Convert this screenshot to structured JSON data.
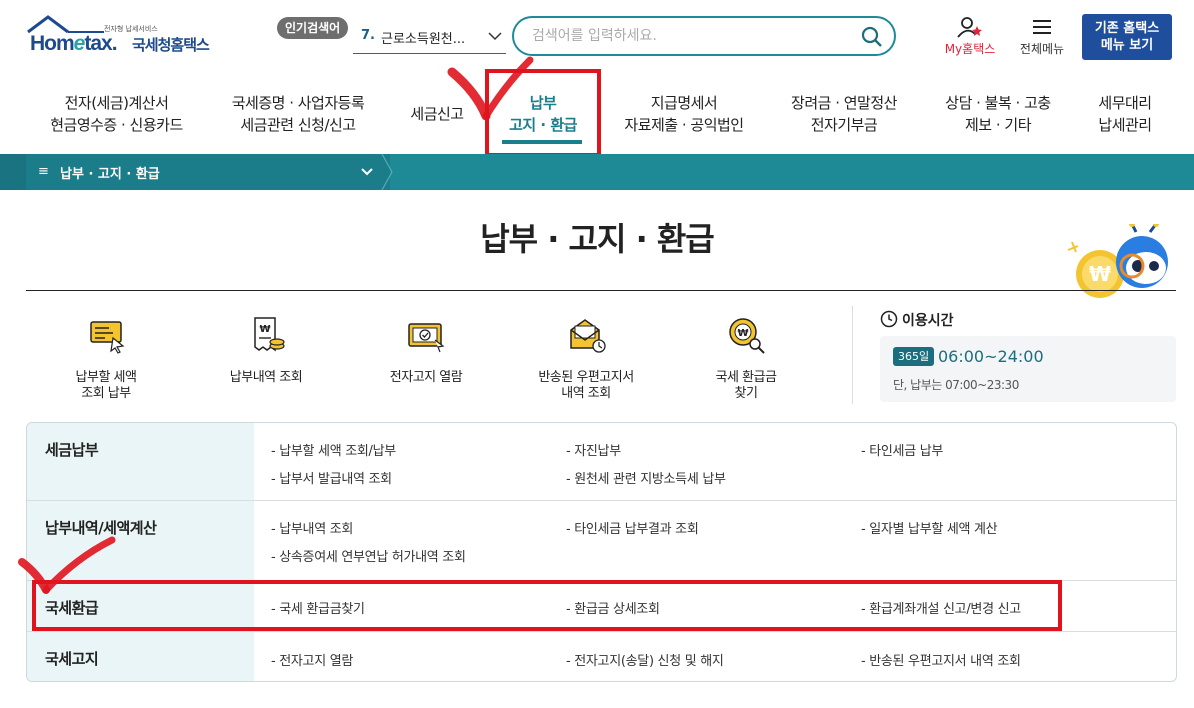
{
  "header": {
    "logo_tagline": "전자형 납세서비스",
    "logo_name_a": "Hom",
    "logo_name_e": "e",
    "logo_name_b": "tax.",
    "logo_kr": "국세청홈택스",
    "popular_badge": "인기검색어",
    "popular_num": "7.",
    "popular_text": "근로소득원천...",
    "search_placeholder": "검색어를 입력하세요.",
    "my_prefix": "My",
    "my_suffix": "홈택스",
    "all_menu": "전체메뉴",
    "old_menu_line1": "기존 홈택스",
    "old_menu_line2": "메뉴 보기"
  },
  "gnb": [
    {
      "line1": "전자(세금)계산서",
      "line2": "현금영수증 · 신용카드"
    },
    {
      "line1": "국세증명 · 사업자등록",
      "line2": "세금관련 신청/신고"
    },
    {
      "line1": "세금신고",
      "line2": ""
    },
    {
      "line1": "납부",
      "line2": "고지 · 환급"
    },
    {
      "line1": "지급명세서",
      "line2": "자료제출 · 공익법인"
    },
    {
      "line1": "장려금 · 연말정산",
      "line2": "전자기부금"
    },
    {
      "line1": "상담 · 불복 · 고충",
      "line2": "제보 · 기타"
    },
    {
      "line1": "세무대리",
      "line2": "납세관리"
    }
  ],
  "breadcrumb": {
    "current": "납부 · 고지 · 환급",
    "menu_icon": "≡"
  },
  "page_title": "납부 · 고지 · 환급",
  "quick_links": [
    {
      "line1": "납부할 세액",
      "line2": "조회 납부",
      "icon": "tax-screen-icon"
    },
    {
      "line1": "납부내역 조회",
      "line2": "",
      "icon": "receipt-coins-icon"
    },
    {
      "line1": "전자고지 열람",
      "line2": "",
      "icon": "e-notice-icon"
    },
    {
      "line1": "반송된 우편고지서",
      "line2": "내역 조회",
      "icon": "returned-mail-icon"
    },
    {
      "line1": "국세 환급금",
      "line2": "찾기",
      "icon": "refund-search-icon"
    }
  ],
  "hours": {
    "title": "이용시간",
    "badge": "365일",
    "time": "06:00~24:00",
    "note": "단, 납부는 07:00~23:30"
  },
  "menu_rows": [
    {
      "title": "세금납부",
      "items": [
        "- 납부할 세액 조회/납부",
        "- 자진납부",
        "- 타인세금 납부",
        "- 납부서 발급내역 조회",
        "- 원천세 관련 지방소득세 납부"
      ]
    },
    {
      "title": "납부내역/세액계산",
      "items": [
        "- 납부내역 조회",
        "- 타인세금 납부결과 조회",
        "- 일자별 납부할 세액 계산",
        "- 상속증여세 연부연납 허가내역 조회"
      ]
    },
    {
      "title": "국세환급",
      "items": [
        "- 국세 환급금찾기",
        "- 환급금 상세조회",
        "- 환급계좌개설 신고/변경 신고"
      ]
    },
    {
      "title": "국세고지",
      "items": [
        "- 전자고지 열람",
        "- 전자고지(송달) 신청 및 해지",
        "- 반송된 우편고지서 내역 조회"
      ]
    }
  ],
  "colors": {
    "accent": "#1e8a96",
    "brand": "#1f4f9c",
    "highlight": "#e0141e"
  }
}
